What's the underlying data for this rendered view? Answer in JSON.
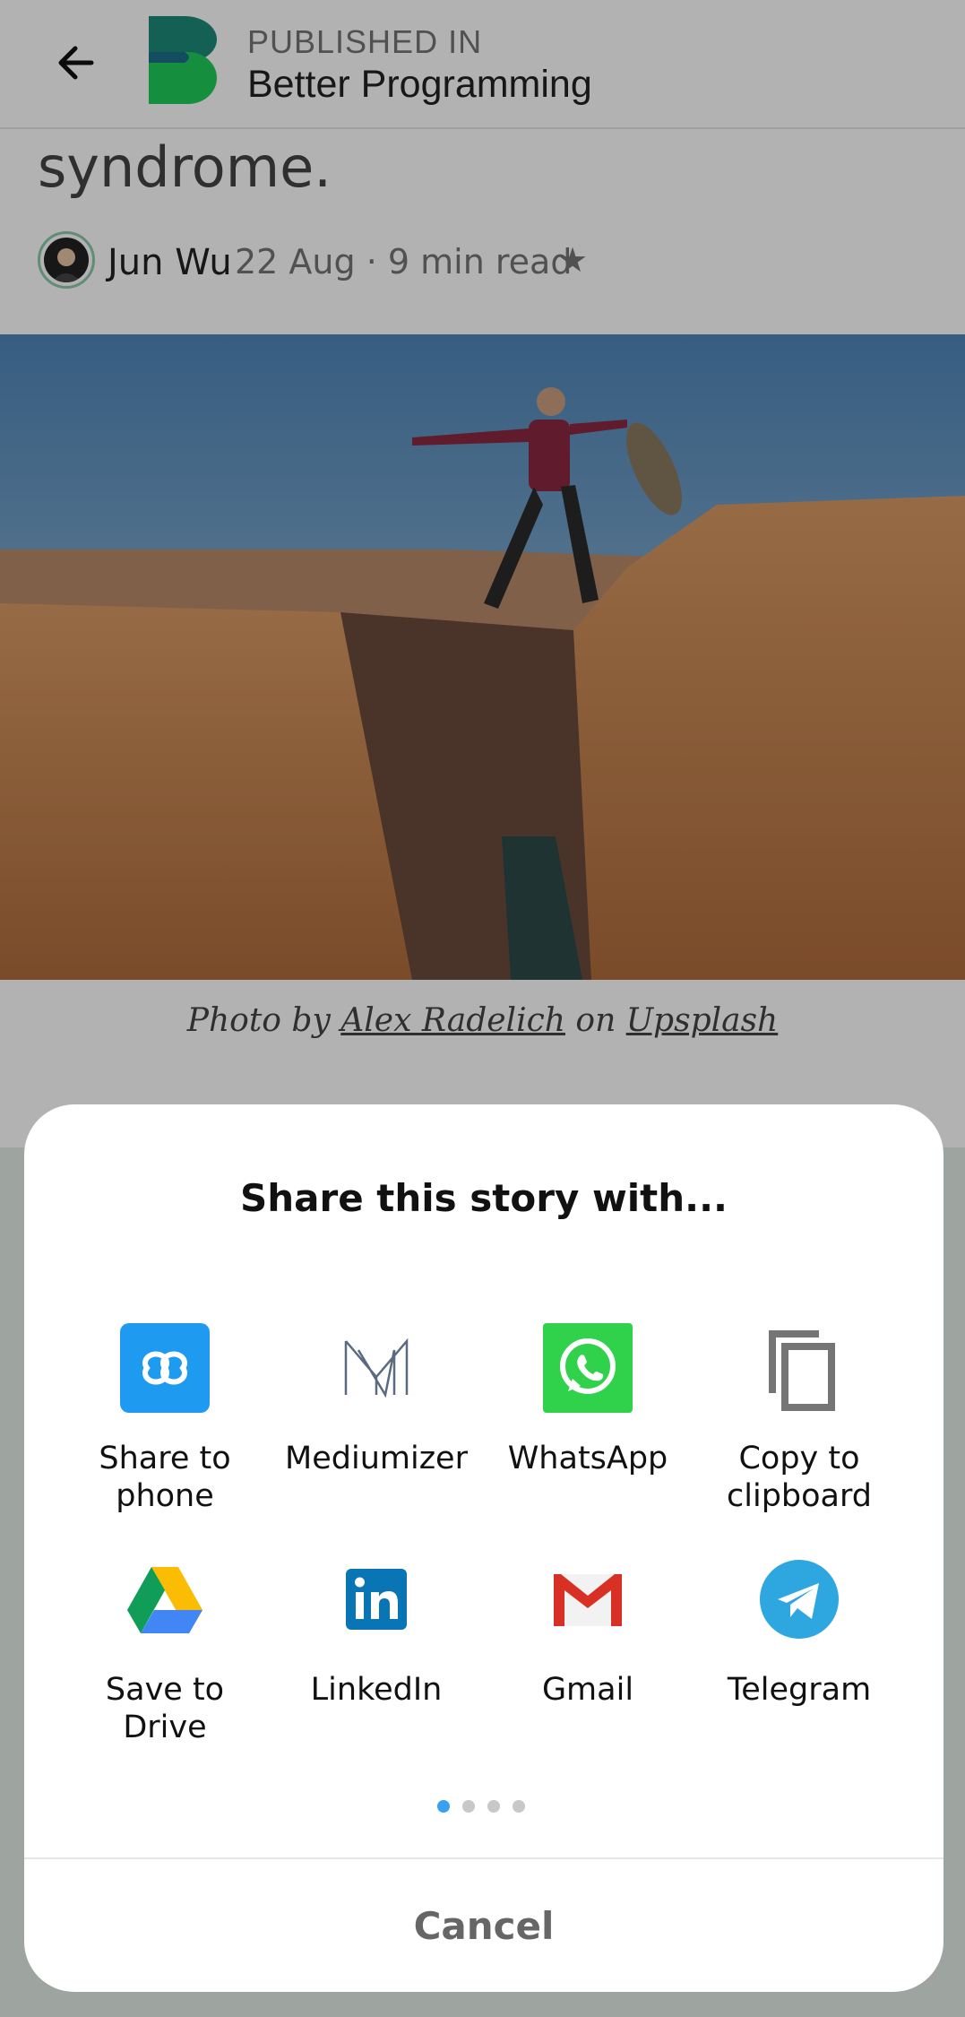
{
  "header": {
    "published_in": "PUBLISHED IN",
    "publication": "Better Programming"
  },
  "article": {
    "headline_tail": "syndrome.",
    "author": "Jun Wu",
    "meta": "22 Aug · 9 min read",
    "photo_caption": {
      "prefix": "Photo by",
      "photographer": "Alex Radelich",
      "mid": "on",
      "source": "Upsplash"
    }
  },
  "share_sheet": {
    "title": "Share this story with...",
    "apps": [
      {
        "label_line1": "Share to",
        "label_line2": "phone",
        "icon": "share-to-phone-icon"
      },
      {
        "label_line1": "Mediumizer",
        "label_line2": "",
        "icon": "mediumizer-icon"
      },
      {
        "label_line1": "WhatsApp",
        "label_line2": "",
        "icon": "whatsapp-icon"
      },
      {
        "label_line1": "Copy to",
        "label_line2": "clipboard",
        "icon": "copy-icon"
      },
      {
        "label_line1": "Save to Drive",
        "label_line2": "",
        "icon": "google-drive-icon"
      },
      {
        "label_line1": "LinkedIn",
        "label_line2": "",
        "icon": "linkedin-icon"
      },
      {
        "label_line1": "Gmail",
        "label_line2": "",
        "icon": "gmail-icon"
      },
      {
        "label_line1": "Telegram",
        "label_line2": "",
        "icon": "telegram-icon"
      }
    ],
    "page_indicator": {
      "pages": 4,
      "active": 1
    },
    "cancel_label": "Cancel"
  },
  "colors": {
    "brand_green": "#1db954",
    "indicator_active": "#3aa0f0",
    "whatsapp": "#2fd24a",
    "telegram": "#2ea6e0",
    "share_phone": "#1e9bf0"
  }
}
